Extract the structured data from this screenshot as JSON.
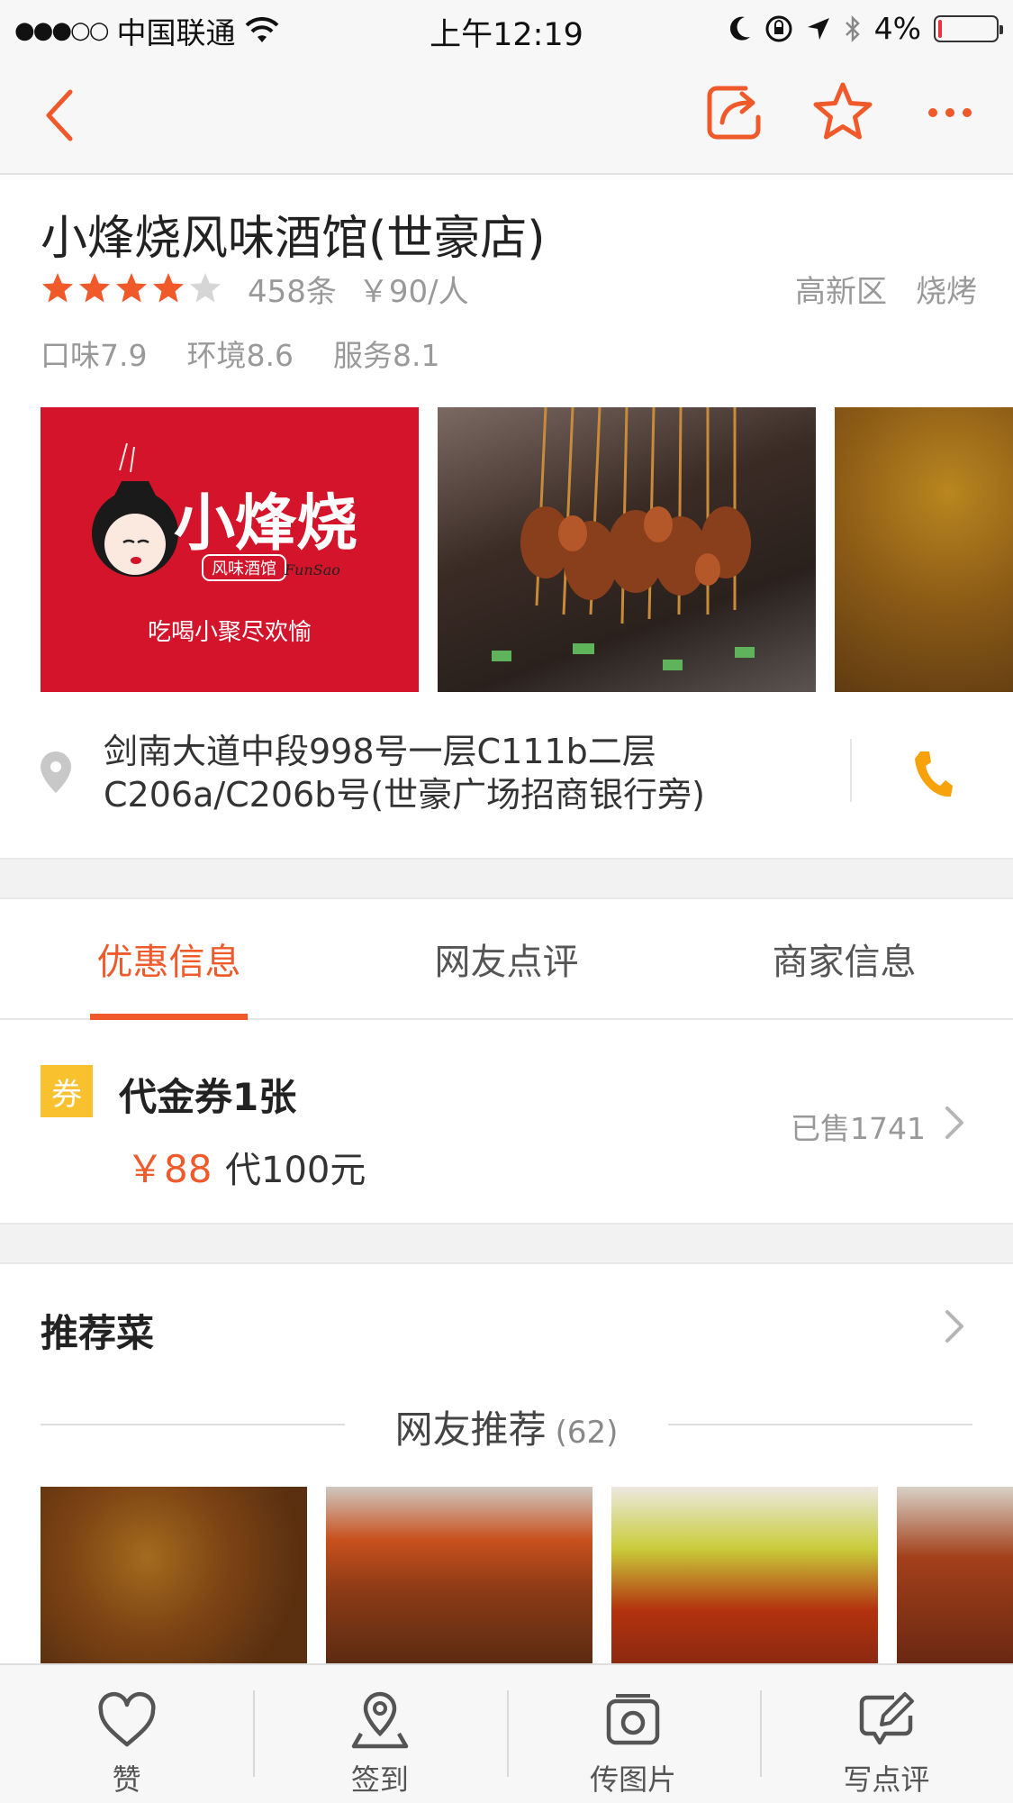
{
  "status_bar": {
    "carrier": "中国联通",
    "signal": "●●●○○",
    "time": "上午12:19",
    "battery": "4%",
    "battery_level": 0.04
  },
  "nav": {
    "back_icon": "chevron-left-icon",
    "share_icon": "share-icon",
    "favorite_icon": "star-outline-icon",
    "more_icon": "more-dots-icon",
    "accent_color": "#f0592a"
  },
  "shop": {
    "name": "小烽烧风味酒馆(世豪店)",
    "rating_stars": 4,
    "rating_max": 5,
    "review_count": "458条",
    "avg_price": "￥90/人",
    "district": "高新区",
    "category": "烧烤",
    "scores": {
      "taste": "口味7.9",
      "environment": "环境8.6",
      "service": "服务8.1"
    }
  },
  "photos": {
    "logo_brand": "小烽烧",
    "logo_sub": "风味酒馆",
    "logo_en": "FunSao",
    "logo_slogan": "吃喝小聚尽欢愉"
  },
  "address": {
    "text": "剑南大道中段998号一层C111b二层C206a/C206b号(世豪广场招商银行旁)",
    "phone_icon": "phone-icon",
    "pin_icon": "location-pin-icon"
  },
  "tabs": [
    {
      "label": "优惠信息",
      "active": true
    },
    {
      "label": "网友点评",
      "active": false
    },
    {
      "label": "商家信息",
      "active": false
    }
  ],
  "coupon": {
    "badge": "券",
    "title": "代金券1张",
    "price": "￥88",
    "value": "代100元",
    "sold": "已售1741"
  },
  "recommended": {
    "title": "推荐菜",
    "subtitle": "网友推荐",
    "count": "(62)"
  },
  "bottom_bar": [
    {
      "label": "赞",
      "icon": "heart-icon"
    },
    {
      "label": "签到",
      "icon": "check-in-pin-icon"
    },
    {
      "label": "传图片",
      "icon": "camera-icon"
    },
    {
      "label": "写点评",
      "icon": "edit-icon"
    }
  ]
}
